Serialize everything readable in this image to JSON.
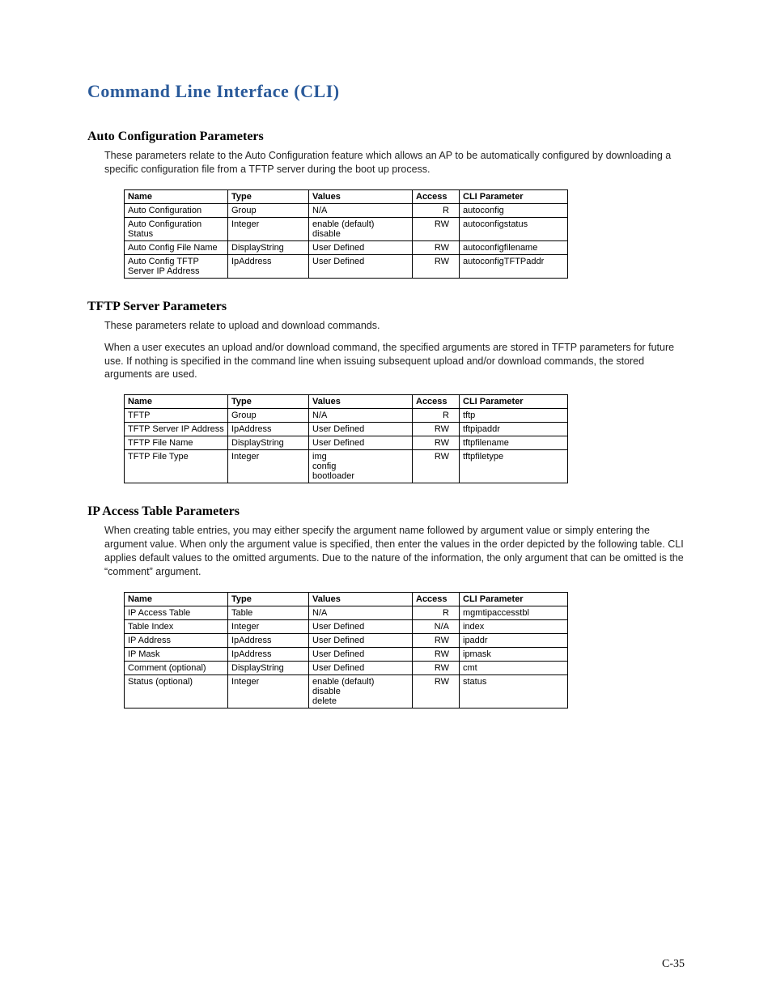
{
  "page_number": "C-35",
  "main_title": "Command Line Interface (CLI)",
  "sections": [
    {
      "title": "Auto Configuration Parameters",
      "paragraphs": [
        "These parameters relate to the Auto Configuration feature which allows an AP to be automatically configured by downloading a specific configuration file from a TFTP server during the boot up process."
      ],
      "columns": [
        "Name",
        "Type",
        "Values",
        "Access",
        "CLI Parameter"
      ],
      "rows": [
        {
          "name": "Auto Configuration",
          "type": "Group",
          "values": "N/A",
          "access": "R",
          "cli": "autoconfig"
        },
        {
          "name": "Auto Configuration Status",
          "type": "Integer",
          "values": "enable (default)\ndisable",
          "access": "RW",
          "cli": "autoconfigstatus"
        },
        {
          "name": "Auto Config File Name",
          "type": "DisplayString",
          "values": "User Defined",
          "access": "RW",
          "cli": "autoconfigfilename"
        },
        {
          "name": "Auto Config TFTP Server IP Address",
          "type": "IpAddress",
          "values": "User Defined",
          "access": "RW",
          "cli": "autoconfigTFTPaddr"
        }
      ]
    },
    {
      "title": "TFTP Server Parameters",
      "paragraphs": [
        "These parameters relate to upload and download commands.",
        "When a user executes an upload and/or download command, the specified arguments are stored in TFTP parameters for future use. If nothing is specified in the command line when issuing subsequent upload and/or download commands, the stored arguments are used."
      ],
      "columns": [
        "Name",
        "Type",
        "Values",
        "Access",
        "CLI Parameter"
      ],
      "rows": [
        {
          "name": "TFTP",
          "type": "Group",
          "values": "N/A",
          "access": "R",
          "cli": "tftp"
        },
        {
          "name": "TFTP Server IP Address",
          "type": "IpAddress",
          "values": "User Defined",
          "access": "RW",
          "cli": "tftpipaddr"
        },
        {
          "name": "TFTP File Name",
          "type": "DisplayString",
          "values": "User Defined",
          "access": "RW",
          "cli": "tftpfilename"
        },
        {
          "name": "TFTP File Type",
          "type": "Integer",
          "values": "img\nconfig\nbootloader",
          "access": "RW",
          "cli": "tftpfiletype"
        }
      ]
    },
    {
      "title": "IP Access Table Parameters",
      "paragraphs": [
        "When creating table entries, you may either specify the argument name followed by argument value or simply entering the argument value. When only the argument value is specified, then enter the values in the order depicted by the following table. CLI applies default values to the omitted arguments. Due to the nature of the information, the only argument that can be omitted is the “comment” argument."
      ],
      "columns": [
        "Name",
        "Type",
        "Values",
        "Access",
        "CLI Parameter"
      ],
      "rows": [
        {
          "name": "IP Access Table",
          "type": "Table",
          "values": "N/A",
          "access": "R",
          "cli": "mgmtipaccesstbl"
        },
        {
          "name": "Table Index",
          "type": "Integer",
          "values": "User Defined",
          "access": "N/A",
          "cli": "index"
        },
        {
          "name": "IP Address",
          "type": "IpAddress",
          "values": "User Defined",
          "access": "RW",
          "cli": "ipaddr"
        },
        {
          "name": "IP Mask",
          "type": "IpAddress",
          "values": "User Defined",
          "access": "RW",
          "cli": "ipmask"
        },
        {
          "name": "Comment (optional)",
          "type": "DisplayString",
          "values": "User Defined",
          "access": "RW",
          "cli": "cmt"
        },
        {
          "name": "Status (optional)",
          "type": "Integer",
          "values": "enable (default)\ndisable\ndelete",
          "access": "RW",
          "cli": "status"
        }
      ]
    }
  ]
}
